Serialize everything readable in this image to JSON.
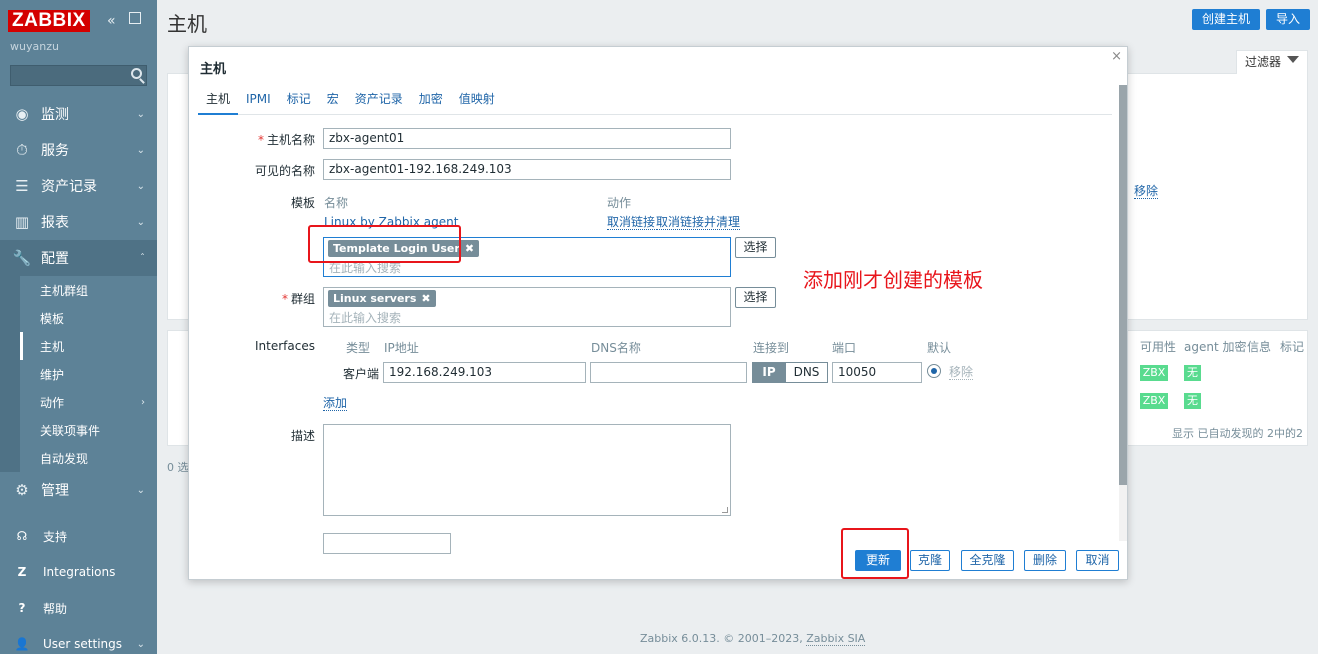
{
  "app": {
    "logo": "ZABBIX",
    "username": "wuyanzu",
    "page_title": "主机",
    "buttons": {
      "create_host": "创建主机",
      "import": "导入"
    },
    "footer": {
      "text": "Zabbix 6.0.13. © 2001–2023, ",
      "link": "Zabbix SIA"
    }
  },
  "sidebar": {
    "menu": [
      {
        "label": "监测",
        "icon": "eye-icon"
      },
      {
        "label": "服务",
        "icon": "stopwatch-icon"
      },
      {
        "label": "资产记录",
        "icon": "list-icon"
      },
      {
        "label": "报表",
        "icon": "bar-chart-icon"
      },
      {
        "label": "配置",
        "icon": "wrench-icon"
      }
    ],
    "config_sub": [
      "主机群组",
      "模板",
      "主机",
      "维护",
      "动作",
      "关联项事件",
      "自动发现"
    ],
    "admin": "管理",
    "bottom": [
      {
        "label": "支持",
        "icon": "headset-icon",
        "glyph": "☊"
      },
      {
        "label": "Integrations",
        "icon": "integrations-icon",
        "glyph": "Z"
      },
      {
        "label": "帮助",
        "icon": "help-icon",
        "glyph": "?"
      },
      {
        "label": "User settings",
        "icon": "user-icon",
        "glyph": "👤"
      }
    ]
  },
  "background": {
    "filter_tab": "过滤器",
    "remove_link": "移除",
    "columns": [
      "可用性",
      "agent 加密",
      "信息",
      "标记"
    ],
    "rows": [
      {
        "availability": "ZBX",
        "encryption": "无"
      },
      {
        "availability": "ZBX",
        "encryption": "无"
      }
    ],
    "summary": "显示 已自动发现的 2中的2",
    "selected_count": "0 选"
  },
  "modal": {
    "title": "主机",
    "close": "×",
    "tabs": [
      "主机",
      "IPMI",
      "标记",
      "宏",
      "资产记录",
      "加密",
      "值映射"
    ],
    "host_name_label": "主机名称",
    "host_name": "zbx-agent01",
    "visible_name_label": "可见的名称",
    "visible_name": "zbx-agent01-192.168.249.103",
    "templates_label": "模板",
    "templates_head_name": "名称",
    "templates_head_action": "动作",
    "linked_template": "Linux by Zabbix agent",
    "unlink": "取消链接",
    "unlink_clear": "取消链接并清理",
    "new_template_tag": "Template Login User",
    "search_placeholder": "在此输入搜索",
    "select_btn": "选择",
    "groups_label": "群组",
    "group_tag": "Linux servers",
    "interfaces_label": "Interfaces",
    "iface_heads": {
      "type": "类型",
      "ip": "IP地址",
      "dns": "DNS名称",
      "connect": "连接到",
      "port": "端口",
      "default": "默认"
    },
    "iface": {
      "type": "客户端",
      "ip": "192.168.249.103",
      "dns": "",
      "connect_ip": "IP",
      "connect_dns": "DNS",
      "port": "10050",
      "remove": "移除"
    },
    "add_link": "添加",
    "description_label": "描述",
    "buttons": {
      "update": "更新",
      "clone": "克隆",
      "full_clone": "全克隆",
      "delete": "删除",
      "cancel": "取消"
    }
  },
  "annotation": {
    "text": "添加刚才创建的模板"
  }
}
